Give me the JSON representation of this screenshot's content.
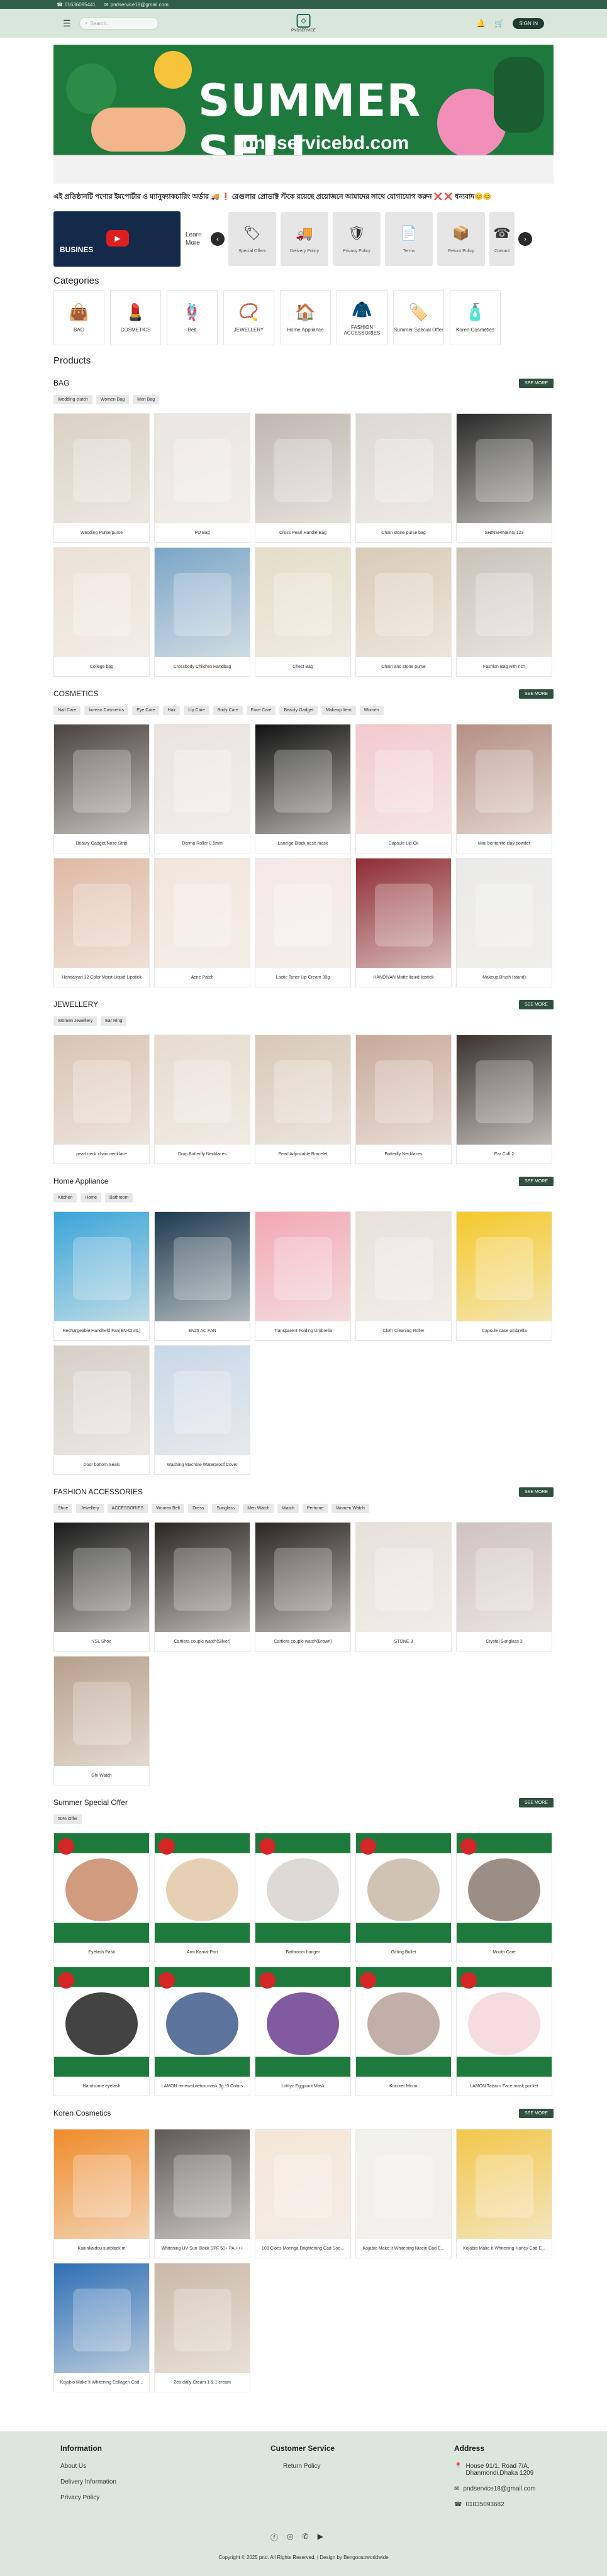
{
  "topbar": {
    "phone": "01636095441",
    "email": "pndservice18@gmail.com"
  },
  "header": {
    "search_placeholder": "Search...",
    "logo_text": "PNDSERVICE",
    "signin": "SIGN IN"
  },
  "banner": {
    "title": "SUMMER SELL",
    "subtitle": "pndservicebd.com"
  },
  "marquee": "এই প্রতিষ্ঠানটি পণ্যের ইমপোর্টার ও ম্যানুফ্যাকচারিং অর্ডার 🚚 ❗ রেগুলার প্রোডাক্ট স্টকে রয়েছে প্রয়োজনে আমাদের সাথে যোগাযোগ করুন ❌ ❌ ধন্যবাদ😊😊",
  "video": {
    "caption": "BUSINES"
  },
  "learn_more": "Learn More",
  "features": [
    "Special Offers",
    "Delivery Policy",
    "Privacy Policy",
    "Terms",
    "Return Policy",
    "Contact"
  ],
  "categories_title": "Categories",
  "categories": [
    {
      "label": "BAG",
      "icon": "👜"
    },
    {
      "label": "COSMETICS",
      "icon": "💄"
    },
    {
      "label": "Belt",
      "icon": "🪢"
    },
    {
      "label": "JEWELLERY",
      "icon": "📿"
    },
    {
      "label": "Home Appliance",
      "icon": "🏠"
    },
    {
      "label": "FASHION ACCESSORIES",
      "icon": "🧥"
    },
    {
      "label": "Summer Special Offer",
      "icon": "🏷️"
    },
    {
      "label": "Koren Cosmetics",
      "icon": "🧴"
    }
  ],
  "products_title": "Products",
  "see_more": "SEE MORE",
  "sections": [
    {
      "name": "BAG",
      "chips": [
        "Wedding clutch",
        "Women Bag",
        "Men Bag"
      ],
      "items": [
        "Wedding Purse/purse",
        "PU Bag",
        "Cross Pearl Handle Bag",
        "Chain stone purse bag",
        "SHINSHINBAG 123",
        "College bag",
        "Crossbody Children Handbag",
        "Chest Bag",
        "Chain and stone purse",
        "Fashion Bag with rich"
      ],
      "colors": [
        "#d9d2c4",
        "#e9e6e1",
        "#bfb8b0",
        "#dcd9d4",
        "#2a2a2a",
        "#ece2d6",
        "#7aa6c8",
        "#e4ddc8",
        "#d8cbb7",
        "#c9c3ba"
      ]
    },
    {
      "name": "COSMETICS",
      "chips": [
        "Nail Care",
        "korean Cosmetics",
        "Eye Care",
        "Hair",
        "Lip Care",
        "Body Care",
        "Face Care",
        "Beauty Gadget",
        "Makeup Item",
        "Women"
      ],
      "items": [
        "Beauty Gadget/Nose Strip",
        "Derma Roller 0.5mm",
        "Laneige Black nose mask",
        "Capsule Lip Oil",
        "Mini bentonite clay powder",
        "Handaiyan 12 Color Moist Liquid Lipstick",
        "Acne Patch",
        "Lactic Toner Lip Cream 30g",
        "HANDIYAN Matte liquid lipstick",
        "Makeup Brush (stand)"
      ],
      "colors": [
        "#4a4440",
        "#e9e4e0",
        "#111111",
        "#f3c9cf",
        "#b58f84",
        "#e0b9a4",
        "#f2e6dc",
        "#f5e8ea",
        "#8e2c34",
        "#eaeaea"
      ]
    },
    {
      "name": "JEWELLERY",
      "chips": [
        "Women Jewellery",
        "Ear Ring"
      ],
      "items": [
        "pearl neck chain necklace",
        "Drop Butterfly Necklaces",
        "Pearl Adjustable Bracelet",
        "Butterfly Necklaces",
        "Ear Cuff 2"
      ],
      "colors": [
        "#d9c4b5",
        "#e6dccf",
        "#d8c8b8",
        "#c9a99a",
        "#3a3330"
      ]
    },
    {
      "name": "Home Appliance",
      "chips": [
        "Kitchen",
        "Home",
        "Bathroom"
      ],
      "items": [
        "Rechargeable Handheld Fan(EN-CIVIL)",
        "EN25 AC FAN",
        "Transparent Folding Umbrella",
        "Cloth Cleaning Roller",
        "Capsule case umbrella",
        "Door bottom Seals",
        "Washing Machine Waterproof Cover"
      ],
      "colors": [
        "#3aa5d8",
        "#1d3a4f",
        "#f2a8b4",
        "#e7e2da",
        "#f4c92a",
        "#d6cfc8",
        "#c7d8e8"
      ]
    },
    {
      "name": "FASHION ACCESSORIES",
      "chips": [
        "Shoe",
        "Jewellery",
        "ACCESSORIES",
        "Women Belt",
        "Dress",
        "Sunglass",
        "Men Watch",
        "Watch",
        "Perfume",
        "Women Watch"
      ],
      "items": [
        "YSL Shoe",
        "Cartiera couple watch(Silver)",
        "Cartiera couple watch(Brown)",
        "STONE 3",
        "Crystal Sunglass 3",
        "Ghi Watch"
      ],
      "colors": [
        "#1a1a1a",
        "#2a2622",
        "#2a2622",
        "#e6e1da",
        "#cfc2c4",
        "#b7a08b"
      ]
    },
    {
      "name": "Summer Special Offer",
      "chips": [
        "50% Offer"
      ],
      "items": [
        "Eyelash Pasti",
        "Arm Kamal Pori",
        "Bathroom hanger",
        "Gifting Bullet",
        "Mouth Care",
        "Handsome eyelash",
        "LAMON renewal detox mask 3g *3 Colors",
        "Lottlyz Eggplant Mask",
        "Kocorer Mirror",
        "LAMON Tatsuru Face mask pocket"
      ],
      "colors": [
        "#1e7a3c",
        "#1e7a3c",
        "#1e7a3c",
        "#1e7a3c",
        "#1e7a3c",
        "#1e7a3c",
        "#1e7a3c",
        "#1e7a3c",
        "#1e7a3c",
        "#1e7a3c"
      ]
    },
    {
      "name": "Koren Cosmetics",
      "chips": [],
      "items": [
        "Kaiunkaidou sunblock m",
        "Whitening UV Sun Block SPF 50+ PA +++",
        "100 Cloes Moringa Brightening Cad Soo...",
        "Kojabio Make It Whitening Niacin Cad E...",
        "Kojabio Make It Whitening Honey Cad E...",
        "Kojabio Make It Whitening Collagen Cad...",
        "Zeo daily Cream 1 & 1 cream"
      ],
      "colors": [
        "#f08b2a",
        "#5d5a58",
        "#f4e6d8",
        "#f1f1ec",
        "#f2c74a",
        "#2d6fb5",
        "#c9b8a8"
      ]
    }
  ],
  "footer": {
    "col1_title": "Information",
    "col1": [
      "About Us",
      "Delivery Information",
      "Privacy Policy"
    ],
    "col2_title": "Customer Service",
    "col2": [
      "Return Policy"
    ],
    "col3_title": "Address",
    "address": "House 91/1, Road 7/A, Dhanmondi,Dhaka 1209",
    "email": "pndservice18@gmail.com",
    "phone": "01835093682",
    "copyright": "Copyright © 2025 pnd. All Rights Reserved. | Design by Bengoosoworldwide"
  }
}
